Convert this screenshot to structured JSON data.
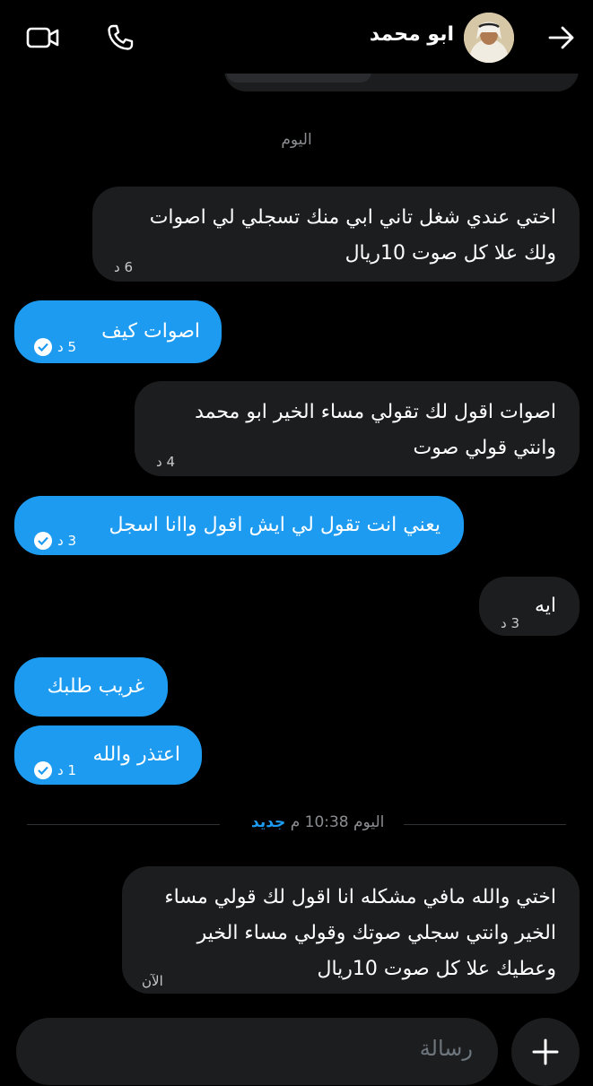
{
  "header": {
    "contact_name": "ابو محمد"
  },
  "day_separator": "اليوم",
  "messages": [
    {
      "dir": "in",
      "lines": [
        "اختي عندي شغل تاني ابي منك تسجلي لي اصوات",
        "ولك علا كل صوت 10ريال"
      ],
      "time": "6 د"
    },
    {
      "dir": "out",
      "lines": [
        "اصوات كيف"
      ],
      "time": "5 د"
    },
    {
      "dir": "in",
      "lines": [
        "اصوات اقول لك تقولي مساء الخير ابو محمد",
        "وانتي قولي صوت"
      ],
      "time": "4 د"
    },
    {
      "dir": "out",
      "lines": [
        "يعني انت تقول لي ايش اقول واانا اسجل"
      ],
      "time": "3 د"
    },
    {
      "dir": "in",
      "lines": [
        "ايه"
      ],
      "time": "3 د"
    },
    {
      "dir": "out",
      "lines": [
        "غريب طلبك"
      ],
      "time": ""
    },
    {
      "dir": "out",
      "lines": [
        "اعتذر والله"
      ],
      "time": "1 د"
    },
    {
      "dir": "in",
      "lines": [
        "اختي والله مافي مشكله انا اقول لك قولي مساء",
        "الخير  وانتي سجلي صوتك وقولي مساء الخير",
        "وعطيك علا كل صوت 10ريال"
      ],
      "time": "الآن"
    }
  ],
  "new_separator": {
    "time": "اليوم 10:38 م",
    "new_label": "جديد"
  },
  "composer": {
    "placeholder": "رسالة"
  }
}
